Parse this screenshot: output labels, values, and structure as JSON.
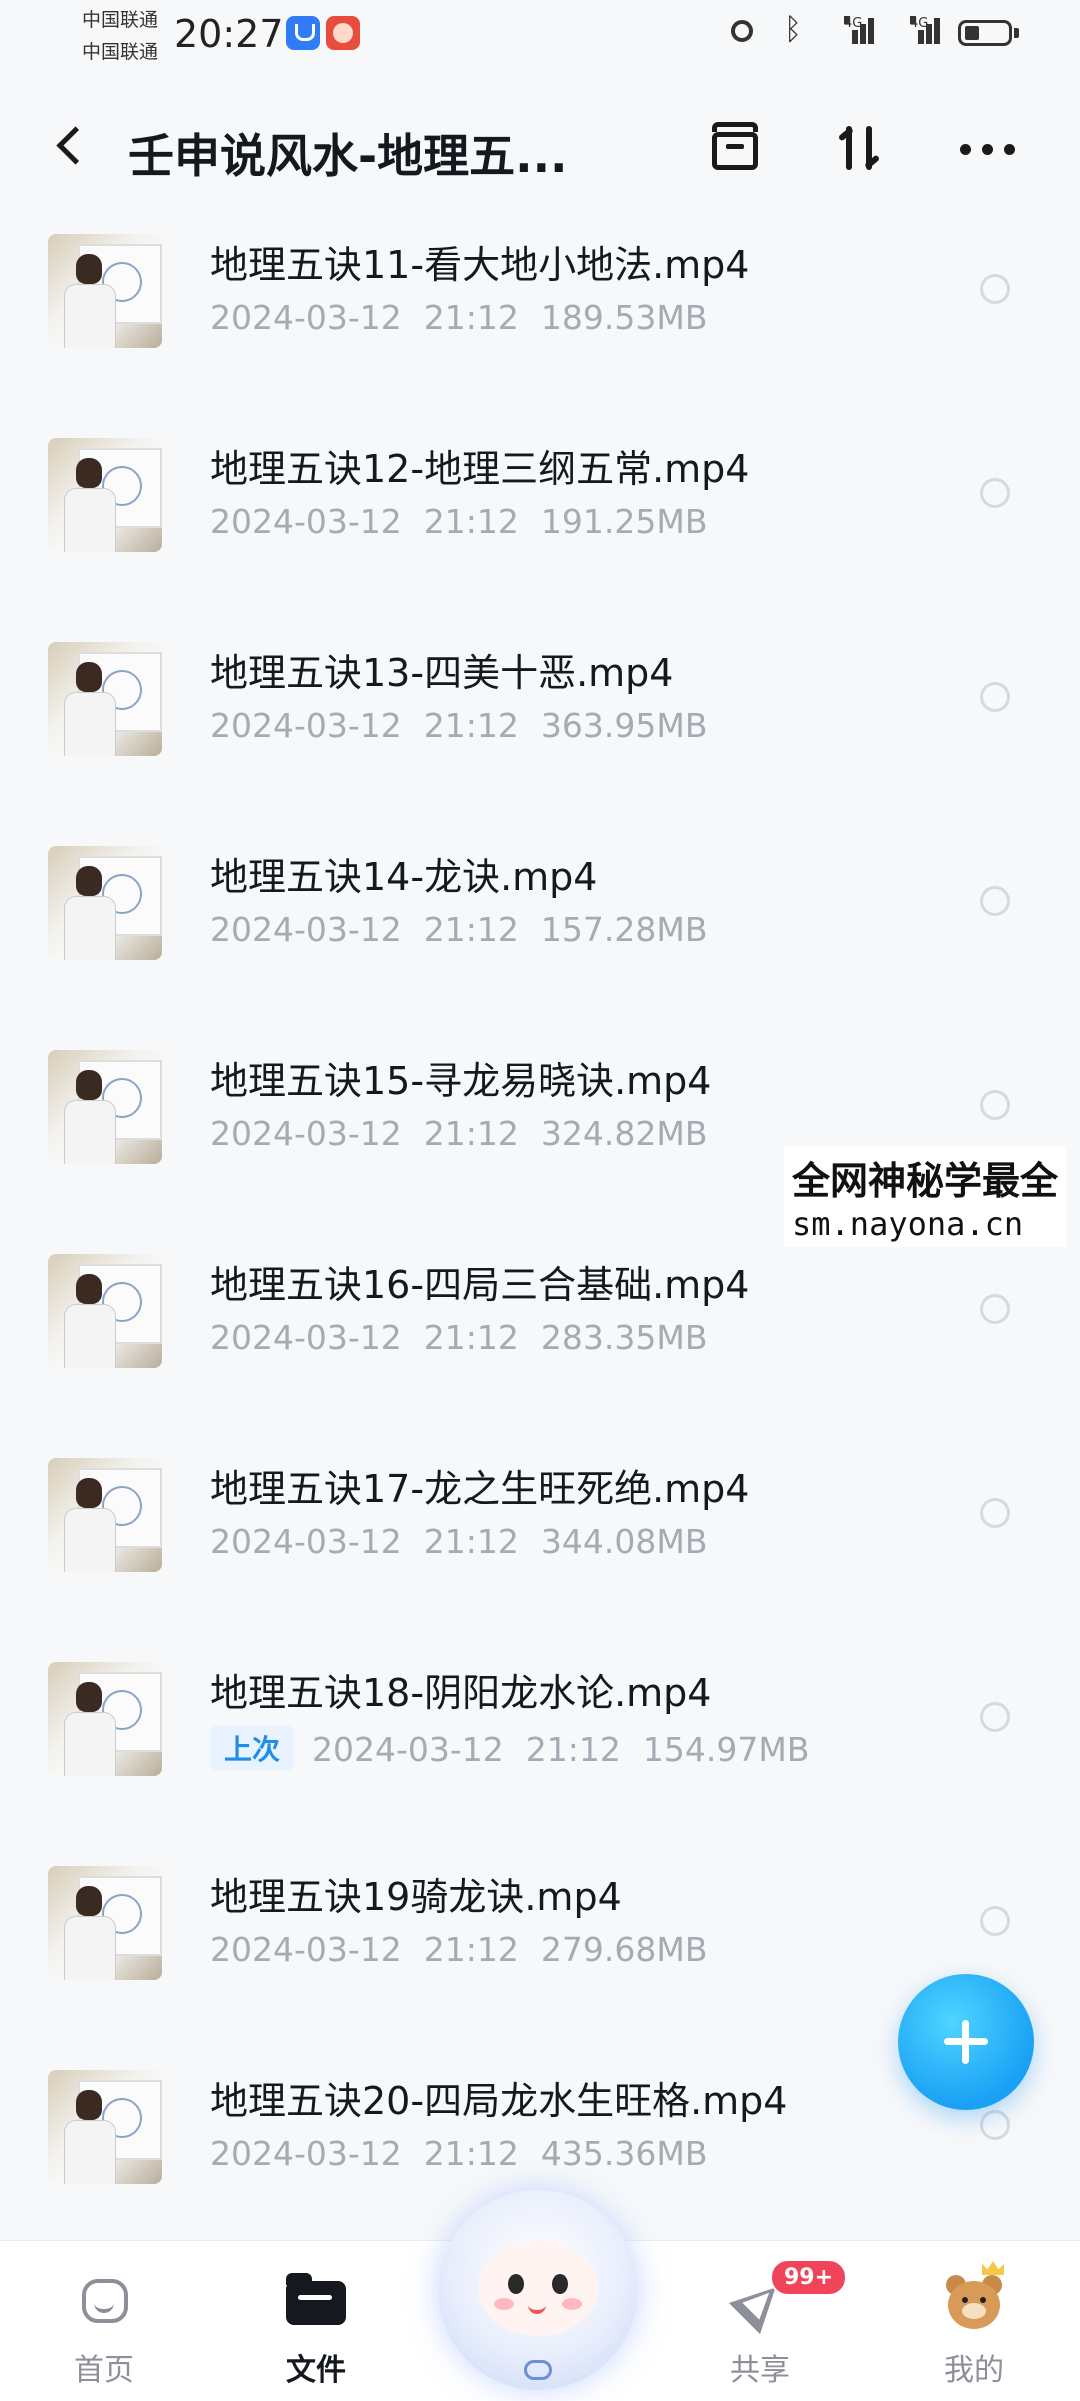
{
  "status_bar": {
    "carrier_1": "中国联通",
    "carrier_2": "中国联通",
    "time": "20:27",
    "network_1": "4G",
    "network_2": "4G"
  },
  "header": {
    "title": "壬申说风水-地理五..."
  },
  "files": [
    {
      "name": "地理五诀11-看大地小地法.mp4",
      "date": "2024-03-12",
      "time": "21:12",
      "size": "189.53MB",
      "badge": ""
    },
    {
      "name": "地理五诀12-地理三纲五常.mp4",
      "date": "2024-03-12",
      "time": "21:12",
      "size": "191.25MB",
      "badge": ""
    },
    {
      "name": "地理五诀13-四美十恶.mp4",
      "date": "2024-03-12",
      "time": "21:12",
      "size": "363.95MB",
      "badge": ""
    },
    {
      "name": "地理五诀14-龙诀.mp4",
      "date": "2024-03-12",
      "time": "21:12",
      "size": "157.28MB",
      "badge": ""
    },
    {
      "name": "地理五诀15-寻龙易晓诀.mp4",
      "date": "2024-03-12",
      "time": "21:12",
      "size": "324.82MB",
      "badge": ""
    },
    {
      "name": "地理五诀16-四局三合基础.mp4",
      "date": "2024-03-12",
      "time": "21:12",
      "size": "283.35MB",
      "badge": ""
    },
    {
      "name": "地理五诀17-龙之生旺死绝.mp4",
      "date": "2024-03-12",
      "time": "21:12",
      "size": "344.08MB",
      "badge": ""
    },
    {
      "name": "地理五诀18-阴阳龙水论.mp4",
      "date": "2024-03-12",
      "time": "21:12",
      "size": "154.97MB",
      "badge": "上次"
    },
    {
      "name": "地理五诀19骑龙诀.mp4",
      "date": "2024-03-12",
      "time": "21:12",
      "size": "279.68MB",
      "badge": ""
    },
    {
      "name": "地理五诀20-四局龙水生旺格.mp4",
      "date": "2024-03-12",
      "time": "21:12",
      "size": "435.36MB",
      "badge": ""
    }
  ],
  "watermark": {
    "line1": "全网神秘学最全",
    "line2": "sm.nayona.cn"
  },
  "bottom_nav": {
    "home": "首页",
    "files": "文件",
    "share": "共享",
    "share_badge": "99+",
    "mine": "我的"
  },
  "colors": {
    "accent": "#1aa1f5",
    "badge": "#f0445a",
    "last_played": "#1f8ee8"
  }
}
